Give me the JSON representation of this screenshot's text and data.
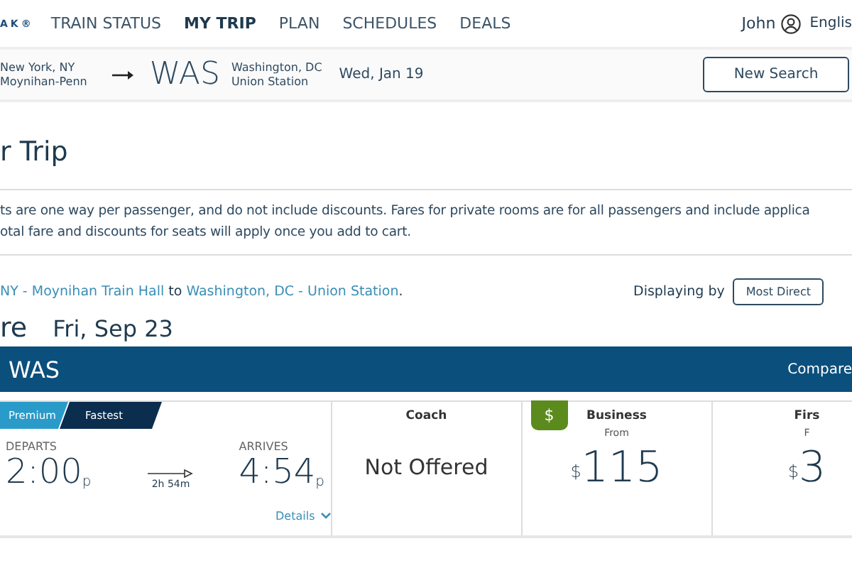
{
  "nav": {
    "logo": "AK®",
    "items": [
      {
        "label": "TRAIN STATUS",
        "selected": false
      },
      {
        "label": "MY TRIP",
        "selected": true
      },
      {
        "label": "PLAN",
        "selected": false
      },
      {
        "label": "SCHEDULES",
        "selected": false
      },
      {
        "label": "DEALS",
        "selected": false
      }
    ],
    "user": "John",
    "language": "Englis"
  },
  "trip_bar": {
    "origin": [
      "New York, NY",
      "Moynihan-Penn"
    ],
    "destination_code": "WAS",
    "destination": [
      "Washington, DC",
      "Union Station"
    ],
    "date": "Wed, Jan 19",
    "button": "New Search"
  },
  "heading": "r Trip",
  "notice": [
    "ts are one way per passenger, and do not include discounts. Fares for private rooms are for all passengers and include applica",
    "otal fare and discounts for seats will apply once you add to cart."
  ],
  "route": {
    "from": "NY - Moynihan Train Hall",
    "joiner": "to",
    "to": "Washington, DC - Union Station",
    "end": ".",
    "sort_label": "Displaying by",
    "sort_button": "Most Direct"
  },
  "depart": {
    "title": "re",
    "date": "Fri, Sep 23"
  },
  "result_bar": {
    "code": "WAS",
    "compare": "Compare"
  },
  "train": {
    "tags": [
      {
        "label": "Premium",
        "kind": "light"
      },
      {
        "label": "Fastest",
        "kind": "dark"
      }
    ],
    "departs_label": "DEPARTS",
    "departs": "2:00",
    "departs_suffix": "p",
    "duration": "2h 54m",
    "arrives_label": "ARRIVES",
    "arrives": "4:54",
    "arrives_suffix": "p",
    "details": "Details",
    "fares": [
      {
        "kind": "none",
        "class": "Coach",
        "text": "Not Offered"
      },
      {
        "kind": "price",
        "class": "Business",
        "from": "From",
        "currency": "$",
        "price": "115",
        "badge": "$"
      },
      {
        "kind": "price",
        "class": "Firs",
        "from": "F",
        "currency": "$",
        "price": "3"
      }
    ]
  }
}
